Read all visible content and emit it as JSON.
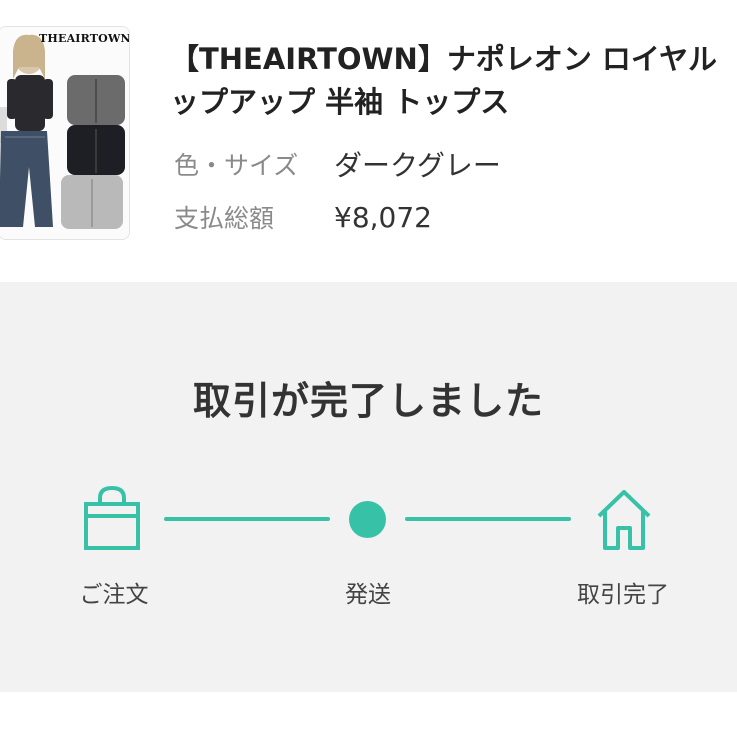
{
  "product": {
    "thumbnail_brand": "THEAIRTOWN",
    "title_line1": "【THEAIRTOWN】ナポレオン ロイヤル",
    "title_line2": "ップアップ 半袖 トップス",
    "color_size_label": "色・サイズ",
    "color_size_value": "ダークグレー",
    "total_label": "支払総額",
    "total_value": "¥8,072"
  },
  "status": {
    "title": "取引が完了しました",
    "accent_color": "#37c1a6",
    "steps": [
      {
        "label": "ご注文",
        "icon": "shopping-bag-icon"
      },
      {
        "label": "発送",
        "icon": "dot-icon"
      },
      {
        "label": "取引完了",
        "icon": "house-icon"
      }
    ]
  }
}
